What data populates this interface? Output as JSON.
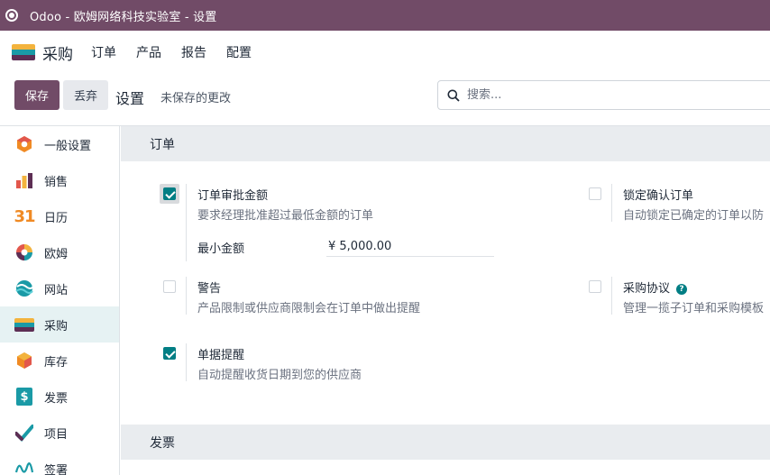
{
  "window": {
    "title": "Odoo - 欧姆网络科技实验室 - 设置"
  },
  "navbar": {
    "app_name": "采购",
    "menu": [
      "订单",
      "产品",
      "报告",
      "配置"
    ]
  },
  "control_panel": {
    "save_label": "保存",
    "discard_label": "丢弃",
    "title": "设置",
    "unsaved": "未保存的更改",
    "search_placeholder": "搜索..."
  },
  "sidebar": {
    "items": [
      {
        "label": "一般设置",
        "icon": "general-settings-icon"
      },
      {
        "label": "销售",
        "icon": "sales-icon"
      },
      {
        "label": "日历",
        "icon": "calendar-icon",
        "glyph": "31"
      },
      {
        "label": "欧姆",
        "icon": "ohm-icon"
      },
      {
        "label": "网站",
        "icon": "website-icon"
      },
      {
        "label": "采购",
        "icon": "purchase-icon",
        "active": true
      },
      {
        "label": "库存",
        "icon": "inventory-icon"
      },
      {
        "label": "发票",
        "icon": "invoicing-icon",
        "glyph": "$"
      },
      {
        "label": "项目",
        "icon": "project-icon"
      },
      {
        "label": "签署",
        "icon": "sign-icon"
      }
    ]
  },
  "sections": {
    "orders": {
      "title": "订单",
      "settings": [
        {
          "title": "订单审批金额",
          "desc": "要求经理批准超过最低金额的订单",
          "checked": true,
          "field": {
            "label": "最小金额",
            "value": "¥ 5,000.00"
          }
        },
        {
          "title": "锁定确认订单",
          "desc": "自动锁定已确定的订单以防",
          "checked": false
        },
        {
          "title": "警告",
          "desc": "产品限制或供应商限制会在订单中做出提醒",
          "checked": false
        },
        {
          "title": "采购协议",
          "desc": "管理一揽子订单和采购模板",
          "checked": false,
          "help": "?"
        },
        {
          "title": "单据提醒",
          "desc": "自动提醒收货日期到您的供应商",
          "checked": true
        }
      ]
    },
    "invoices": {
      "title": "发票"
    }
  },
  "colors": {
    "brand": "#714b67",
    "accent": "#017e84",
    "active_bg": "#e6f2f3"
  }
}
